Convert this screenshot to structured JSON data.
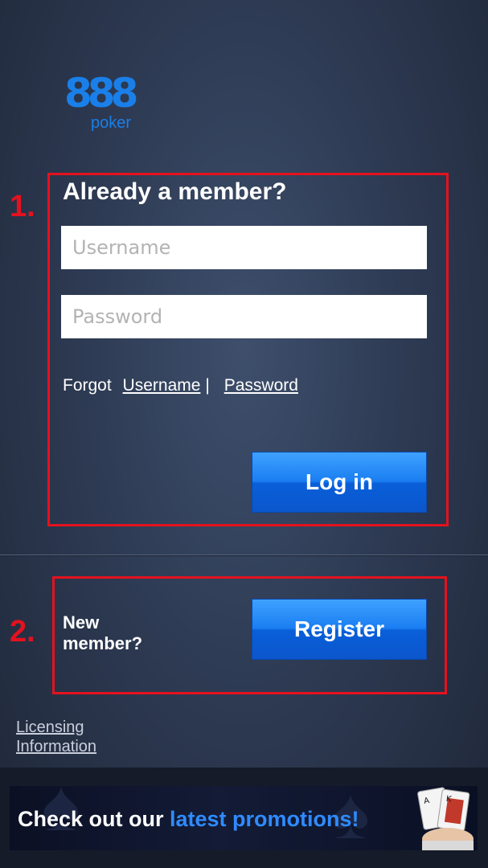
{
  "logo": {
    "brand_number": "888",
    "brand_word": "poker"
  },
  "markers": {
    "one": "1.",
    "two": "2."
  },
  "login": {
    "heading": "Already a member?",
    "username_placeholder": "Username",
    "password_placeholder": "Password",
    "forgot_label": "Forgot",
    "forgot_username": "Username",
    "separator": "|",
    "forgot_password": "Password",
    "login_button": "Log in"
  },
  "register": {
    "new_member": "New member?",
    "register_button": "Register"
  },
  "footer": {
    "licensing_line1": "Licensing",
    "licensing_line2": "Information"
  },
  "promo": {
    "text_white": "Check out our ",
    "text_blue": "latest promotions!"
  },
  "colors": {
    "brand_blue": "#1a7fe8",
    "highlight_red": "#e4121e",
    "button_blue": "#1a7ef2"
  }
}
